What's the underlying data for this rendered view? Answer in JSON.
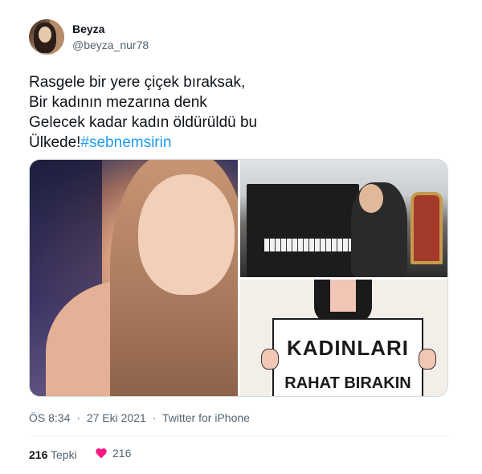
{
  "author": {
    "name": "Beyza",
    "handle": "@beyza_nur78",
    "avatar_icon": "profile-photo"
  },
  "tweet": {
    "lines": [
      "Rasgele bir yere çiçek bıraksak,",
      "Bir kadının mezarına denk",
      "Gelecek kadar kadın öldürüldü bu",
      "Ülkede!"
    ],
    "hashtag": "#sebnemsirin",
    "hashtag_color": "#1d9bf0"
  },
  "media": {
    "image_count": 3,
    "sign_text_line1": "KADINLARI",
    "sign_text_line2": "RAHAT BIRAKIN"
  },
  "meta": {
    "time": "ÖS 8:34",
    "sep1": "·",
    "date": "27 Eki 2021",
    "sep2": "·",
    "source": "Twitter for iPhone"
  },
  "stats": {
    "reactions_count": "216",
    "reactions_label": "Tepki",
    "likes_count": "216",
    "like_color": "#f91880"
  }
}
